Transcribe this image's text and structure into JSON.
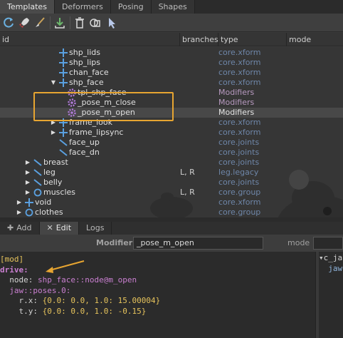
{
  "tabs": [
    {
      "label": "Templates"
    },
    {
      "label": "Deformers"
    },
    {
      "label": "Posing"
    },
    {
      "label": "Shapes"
    }
  ],
  "toolbar": {
    "icons": [
      "refresh-icon",
      "rocket-icon",
      "brush-icon",
      "import-icon",
      "trash-icon",
      "duplicate-icon",
      "select-arrow-icon"
    ]
  },
  "columns": {
    "id": "id",
    "branches": "branches",
    "type": "type",
    "mode": "mode"
  },
  "tree": [
    {
      "name": "shp_lids",
      "type": "core.xform",
      "branches": "",
      "icon": "xform-icon"
    },
    {
      "name": "shp_lips",
      "type": "core.xform",
      "branches": "",
      "icon": "xform-icon"
    },
    {
      "name": "chan_face",
      "type": "core.xform",
      "branches": "",
      "icon": "xform-icon"
    },
    {
      "name": "shp_face",
      "type": "core.xform",
      "branches": "",
      "icon": "xform-icon"
    },
    {
      "name": "tpl_shp_face",
      "type": "Modifiers",
      "branches": "",
      "icon": "gear-icon"
    },
    {
      "name": "_pose_m_close",
      "type": "Modifiers",
      "branches": "",
      "icon": "gear-icon"
    },
    {
      "name": "_pose_m_open",
      "type": "Modifiers",
      "branches": "",
      "icon": "gear-icon"
    },
    {
      "name": "frame_look",
      "type": "core.xform",
      "branches": "",
      "icon": "xform-icon"
    },
    {
      "name": "frame_lipsync",
      "type": "core.xform",
      "branches": "",
      "icon": "xform-icon"
    },
    {
      "name": "face_up",
      "type": "core.joints",
      "branches": "",
      "icon": "joints-icon"
    },
    {
      "name": "face_dn",
      "type": "core.joints",
      "branches": "",
      "icon": "joints-icon"
    },
    {
      "name": "breast",
      "type": "core.joints",
      "branches": "",
      "icon": "joints-icon"
    },
    {
      "name": "leg",
      "type": "leg.legacy",
      "branches": "L, R",
      "icon": "joints-icon"
    },
    {
      "name": "belly",
      "type": "core.joints",
      "branches": "",
      "icon": "joints-icon"
    },
    {
      "name": "muscles",
      "type": "core.group",
      "branches": "L, R",
      "icon": "group-icon"
    },
    {
      "name": "void",
      "type": "core.xform",
      "branches": "",
      "icon": "xform-icon"
    },
    {
      "name": "clothes",
      "type": "core.group",
      "branches": "",
      "icon": "group-icon"
    }
  ],
  "bottom_tabs": [
    {
      "label": "Add"
    },
    {
      "label": "Edit"
    },
    {
      "label": "Logs"
    }
  ],
  "modifier": {
    "label": "Modifier",
    "value": "_pose_m_open",
    "mode_label": "mode"
  },
  "code": {
    "line1": "[mod]",
    "line2": "drive:",
    "line3_key": "node: ",
    "line3_val": "shp_face::node@m_open",
    "line4": "jaw::poses.0:",
    "line5_key": "r.x: ",
    "line5_val": "{0.0: 0.0, 1.0: 15.00004}",
    "line6_key": "t.y: ",
    "line6_val": "{0.0: 0.0, 1.0: -0.15}"
  },
  "side_panel": {
    "item1": "c_ja",
    "item2": "jaw"
  },
  "colors": {
    "highlight_box": "#e7a531",
    "type_xform": "#6e86a8",
    "type_modifier": "#b89ac0"
  }
}
